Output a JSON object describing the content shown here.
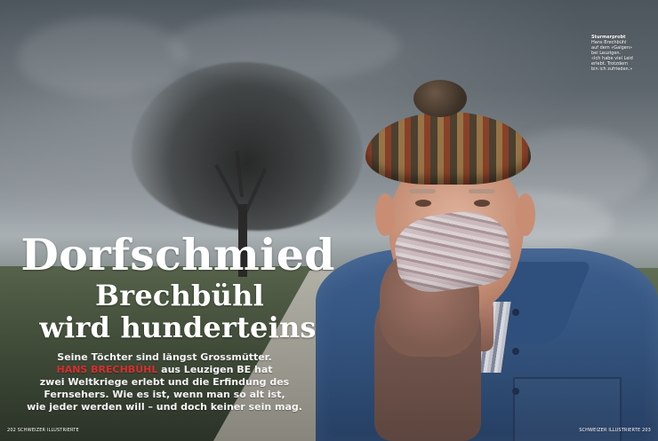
{
  "headline": {
    "line1": "Dorfschmied",
    "line2": "Brechbühl",
    "line3": "wird hunderteins"
  },
  "intro": {
    "line1": "Seine Töchter sind längst Grossmütter.",
    "name": "HANS BRECHBÜHL",
    "line2_rest": " aus Leuzigen BE hat",
    "line3": "zwei Weltkriege erlebt und die Erfindung des",
    "line4": "Fernsehers. Wie es ist, wenn man so alt ist,",
    "line5": "wie jeder werden will – und doch keiner sein mag."
  },
  "caption": {
    "title": "Sturmerprobt",
    "line1": "Hans Brechbühl",
    "line2": "auf dem «Galgen»",
    "line3": "bei Leuzigen.",
    "line4": "«Ich habe viel Leid",
    "line5": "erlebt. Trotzdem",
    "line6": "bin ich zufrieden.»"
  },
  "footer": {
    "left": "202 SCHWEIZER ILLUSTRIERTE",
    "right": "SCHWEIZER ILLUSTRIERTE 203"
  }
}
